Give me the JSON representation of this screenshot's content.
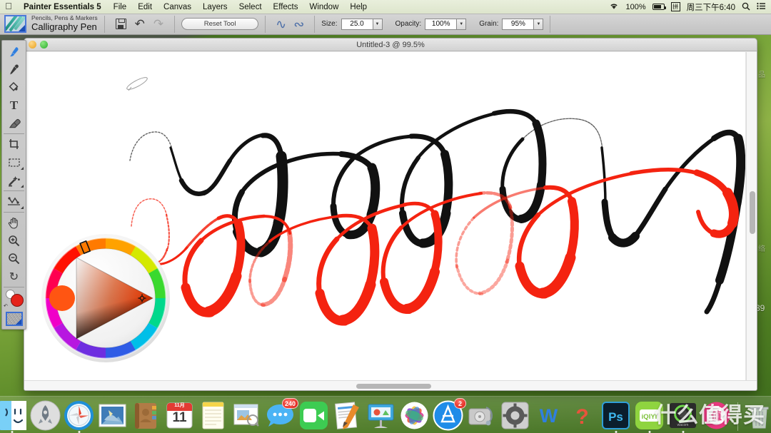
{
  "menubar": {
    "apple_logo": "apple-logo",
    "app_name": "Painter Essentials 5",
    "menus": [
      "File",
      "Edit",
      "Canvas",
      "Layers",
      "Select",
      "Effects",
      "Window",
      "Help"
    ],
    "wifi_icon": "wifi-icon",
    "battery_percent": "100%",
    "battery_icon": "battery-charging-icon",
    "input_source": "拼",
    "clock": "周三下午6:40",
    "spotlight_icon": "search-icon",
    "notification_icon": "notification-center-icon"
  },
  "brushbar": {
    "brush_thumb_icon": "brush-preset-thumbnail",
    "brush_category": "Pencils, Pens & Markers",
    "brush_variant": "Calligraphy Pen",
    "save_icon": "save-icon",
    "undo_icon": "undo-icon",
    "redo_icon": "redo-icon",
    "reset_tool_label": "Reset Tool",
    "stroke_icon_1": "stroke-swirl-icon",
    "stroke_icon_2": "stroke-swirl-filled-icon",
    "size_label": "Size:",
    "size_value": "25.0",
    "opacity_label": "Opacity:",
    "opacity_value": "100%",
    "grain_label": "Grain:",
    "grain_value": "95%",
    "stepper_glyph": "▼"
  },
  "toolbox": {
    "tools": [
      {
        "name": "brush-tool",
        "glyph": "✎",
        "active": true
      },
      {
        "name": "dropper-tool",
        "glyph": "⌁",
        "active": false
      },
      {
        "name": "paint-bucket-tool",
        "glyph": "◔",
        "active": false
      },
      {
        "name": "text-tool",
        "glyph": "T",
        "active": false
      },
      {
        "name": "eraser-tool",
        "glyph": "◨",
        "active": false
      },
      {
        "name": "crop-tool",
        "glyph": "⌗",
        "active": false
      },
      {
        "name": "rectangular-selection-tool",
        "glyph": "▭",
        "active": false
      },
      {
        "name": "magic-wand-tool",
        "glyph": "✦",
        "active": false
      },
      {
        "name": "pen-shape-tool",
        "glyph": "⋎",
        "active": false
      },
      {
        "name": "grabber-hand-tool",
        "glyph": "✋",
        "active": false
      },
      {
        "name": "magnifier-zoom-in-tool",
        "glyph": "⊕",
        "active": false
      },
      {
        "name": "magnifier-zoom-out-tool",
        "glyph": "⊖",
        "active": false
      },
      {
        "name": "rotate-page-tool",
        "glyph": "↻",
        "active": false
      }
    ],
    "primary_color": "#e5231b",
    "secondary_color": "#ffffff",
    "swap_icon": "swap-colors-icon",
    "paper_texture_icon": "paper-texture-swatch"
  },
  "color_wheel": {
    "name": "color-wheel-panel",
    "selected_color": "#ff4a10",
    "hue_marker_position_deg": 340,
    "current_swatch_color": "#ff5512",
    "crosshair_icon": "color-picker-crosshair"
  },
  "document": {
    "title": "Untitled-3 @ 99.5%",
    "zoom": "99.5%",
    "name": "Untitled-3",
    "minimize_button": "minimize-button",
    "zoom_button": "zoom-button",
    "vertical_scrollbar": "vertical-scrollbar",
    "horizontal_scrollbar": "horizontal-scrollbar"
  },
  "artwork": {
    "description": "Two overlapping calligraphy pen strokes with pressure-varying width",
    "strokes": [
      {
        "name": "black-calligraphy-stroke",
        "color": "#111111"
      },
      {
        "name": "red-calligraphy-stroke",
        "color": "#f42310"
      }
    ],
    "brush_cursor_icon": "calligraphy-brush-cursor"
  },
  "desktop": {
    "icons": [
      {
        "name": "desktop-icon-screenshot-1",
        "label": ""
      },
      {
        "name": "desktop-icon-folder",
        "label": ""
      },
      {
        "name": "desktop-icon-document",
        "label": ""
      }
    ],
    "right_labels": [
      "品",
      "络",
      "39"
    ]
  },
  "dock": {
    "items": [
      {
        "name": "dock-finder",
        "label": "Finder",
        "running": true
      },
      {
        "name": "dock-launchpad",
        "label": "Launchpad",
        "running": false
      },
      {
        "name": "dock-safari",
        "label": "Safari",
        "running": true
      },
      {
        "name": "dock-mail",
        "label": "Mail",
        "running": false
      },
      {
        "name": "dock-contacts",
        "label": "Contacts",
        "running": false
      },
      {
        "name": "dock-calendar",
        "label": "Calendar",
        "running": false,
        "month": "11月",
        "day": "11"
      },
      {
        "name": "dock-notes",
        "label": "Notes",
        "running": false
      },
      {
        "name": "dock-preview",
        "label": "Preview",
        "running": false
      },
      {
        "name": "dock-messages",
        "label": "Messages",
        "running": false,
        "badge": "240"
      },
      {
        "name": "dock-facetime",
        "label": "FaceTime",
        "running": false
      },
      {
        "name": "dock-pages",
        "label": "Pages",
        "running": false
      },
      {
        "name": "dock-keynote",
        "label": "Keynote",
        "running": false
      },
      {
        "name": "dock-photos",
        "label": "Photos",
        "running": false
      },
      {
        "name": "dock-app-store",
        "label": "App Store",
        "running": false,
        "badge": "2"
      },
      {
        "name": "dock-disk-utility",
        "label": "Disk Utility",
        "running": false
      },
      {
        "name": "dock-system-preferences",
        "label": "System Preferences",
        "running": false
      },
      {
        "name": "dock-word",
        "label": "W",
        "running": false
      },
      {
        "name": "dock-painter",
        "label": "?",
        "running": false
      },
      {
        "name": "dock-photoshop",
        "label": "Ps",
        "running": true
      },
      {
        "name": "dock-iqiyi",
        "label": "iQIYI",
        "running": true
      },
      {
        "name": "dock-wacom",
        "label": "wacom",
        "running": true
      },
      {
        "name": "dock-smzdm",
        "label": "值",
        "running": false
      },
      {
        "name": "dock-trash",
        "label": "Trash",
        "running": false
      }
    ]
  },
  "watermark": {
    "text": "什么值得买"
  }
}
